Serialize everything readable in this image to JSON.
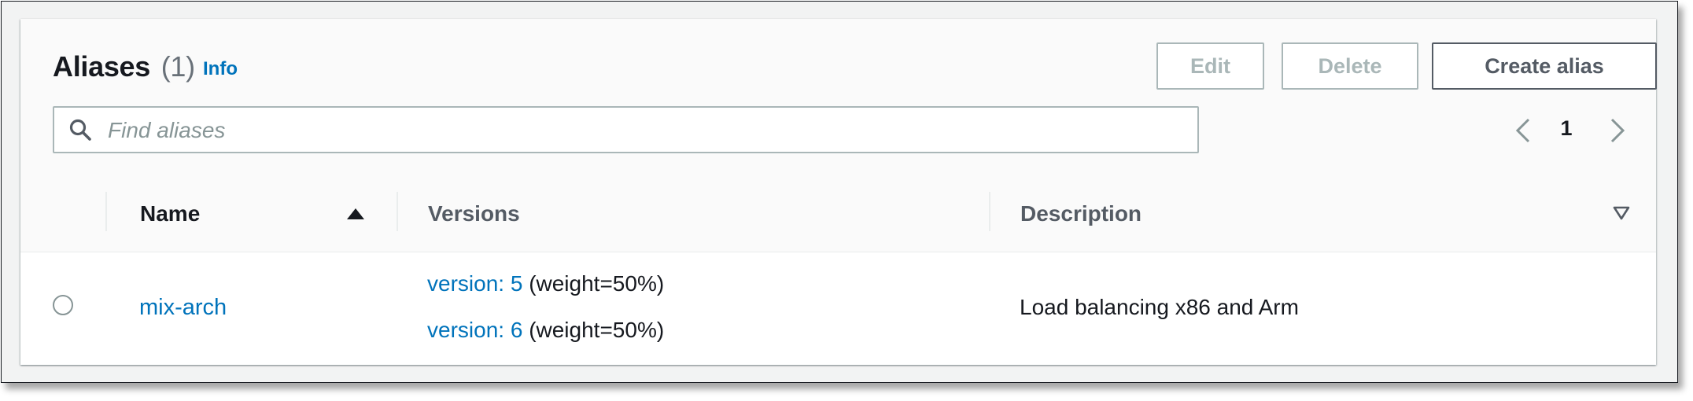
{
  "panel": {
    "title": "Aliases",
    "count": "(1)",
    "info_label": "Info"
  },
  "actions": {
    "edit_label": "Edit",
    "delete_label": "Delete",
    "create_label": "Create alias"
  },
  "search": {
    "placeholder": "Find aliases",
    "value": ""
  },
  "pagination": {
    "current_page": "1"
  },
  "table": {
    "columns": [
      "Name",
      "Versions",
      "Description"
    ],
    "sorted_column": "Name",
    "sort_direction": "ascending",
    "rows": [
      {
        "selected": false,
        "name": "mix-arch",
        "versions": [
          {
            "label": "version: 5",
            "weight": "(weight=50%)"
          },
          {
            "label": "version: 6",
            "weight": "(weight=50%)"
          }
        ],
        "description": "Load balancing x86 and Arm"
      }
    ]
  },
  "colors": {
    "link": "#0073bb",
    "text": "#16191f",
    "muted": "#687078",
    "border_disabled": "#aab7b8",
    "border_normal": "#545b64",
    "header_bg": "#fafafa",
    "page_bg": "#f2f3f3"
  }
}
